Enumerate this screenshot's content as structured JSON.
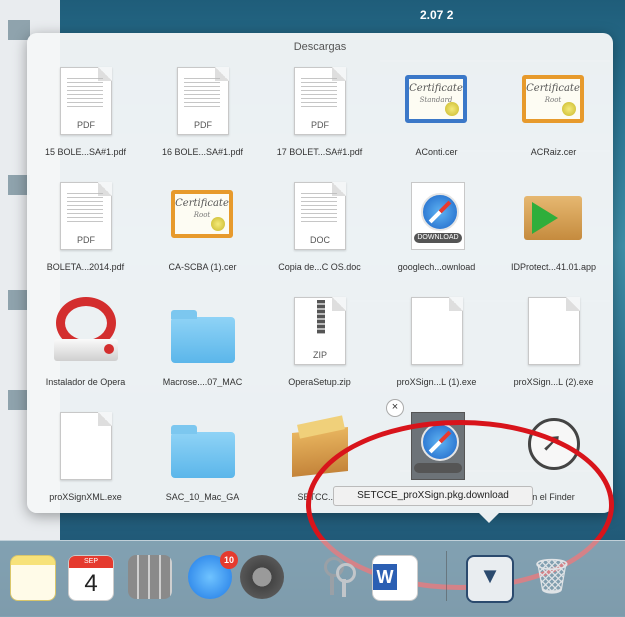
{
  "topbar": {
    "label": "2.07 2"
  },
  "stack": {
    "title": "Descargas",
    "items": [
      {
        "label": "15 BOLE...SA#1.pdf",
        "type": "PDF"
      },
      {
        "label": "16 BOLE...SA#1.pdf",
        "type": "PDF"
      },
      {
        "label": "17 BOLET...SA#1.pdf",
        "type": "PDF"
      },
      {
        "label": "AConti.cer",
        "cert_title": "Certificate",
        "cert_sub": "Standard"
      },
      {
        "label": "ACRaiz.cer",
        "cert_title": "Certificate",
        "cert_sub": "Root"
      },
      {
        "label": "BOLETA...2014.pdf",
        "type": "PDF"
      },
      {
        "label": "CA-SCBA (1).cer",
        "cert_title": "Certificate",
        "cert_sub": "Root"
      },
      {
        "label": "Copia de...C OS.doc",
        "type": "DOC"
      },
      {
        "label": "googlech...ownload",
        "band": "DOWNLOAD"
      },
      {
        "label": "IDProtect...41.01.app"
      },
      {
        "label": "Instalador de Opera"
      },
      {
        "label": "Macrose....07_MAC"
      },
      {
        "label": "OperaSetup.zip",
        "type": "ZIP"
      },
      {
        "label": "proXSign...L (1).exe"
      },
      {
        "label": "proXSign...L (2).exe"
      },
      {
        "label": "proXSignXML.exe"
      },
      {
        "label": "SAC_10_Mac_GA"
      },
      {
        "label": "SETCC...S"
      },
      {
        "label": ""
      },
      {
        "label": "n el Finder"
      }
    ],
    "close_glyph": "×"
  },
  "tooltip": {
    "text": "SETCCE_proXSign.pkg.download"
  },
  "dock": {
    "calendar_month": "SEP",
    "calendar_day": "4",
    "appstore_badge": "10",
    "word_letter": "W",
    "downloads_glyph": "▼",
    "trash_glyph": "🗑"
  },
  "colors": {
    "annotation": "#d8141b",
    "folder": "#5bb6ea"
  }
}
